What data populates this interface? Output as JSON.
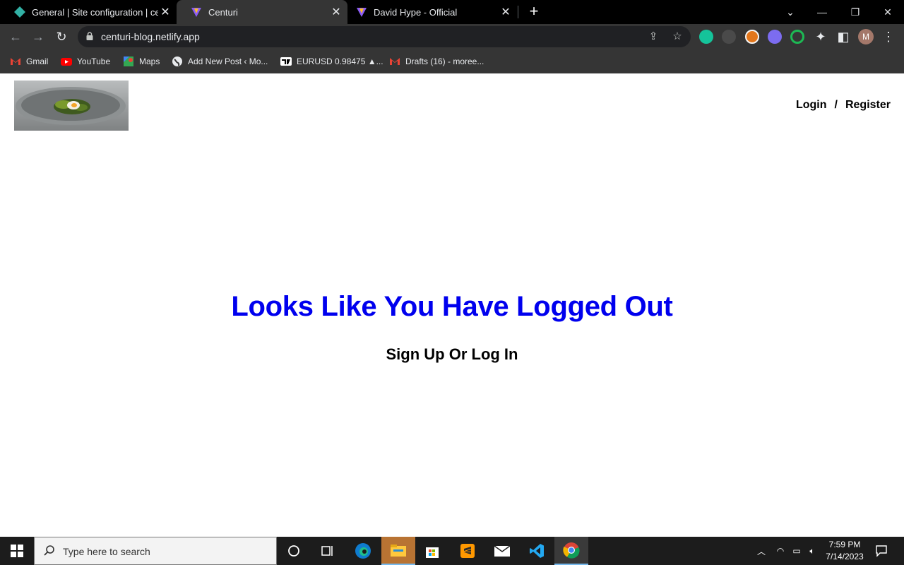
{
  "browser": {
    "tabs": [
      {
        "title": "General | Site configuration | centuri-blog"
      },
      {
        "title": "Centuri"
      },
      {
        "title": "David Hype - Official"
      }
    ],
    "url": "centuri-blog.netlify.app",
    "profile_initial": "M",
    "bookmarks": [
      {
        "label": "Gmail"
      },
      {
        "label": "YouTube"
      },
      {
        "label": "Maps"
      },
      {
        "label": "Add New Post ‹ Mo..."
      },
      {
        "label": "EURUSD 0.98475 ▲..."
      },
      {
        "label": "Drafts (16) - moree..."
      }
    ]
  },
  "page": {
    "nav": {
      "login": "Login",
      "separator": "/",
      "register": "Register"
    },
    "headline": "Looks Like You Have Logged Out",
    "subline": "Sign Up Or Log In",
    "colors": {
      "headline": "#0000ee"
    }
  },
  "taskbar": {
    "search_placeholder": "Type here to search",
    "time": "7:59 PM",
    "date": "7/14/2023"
  }
}
